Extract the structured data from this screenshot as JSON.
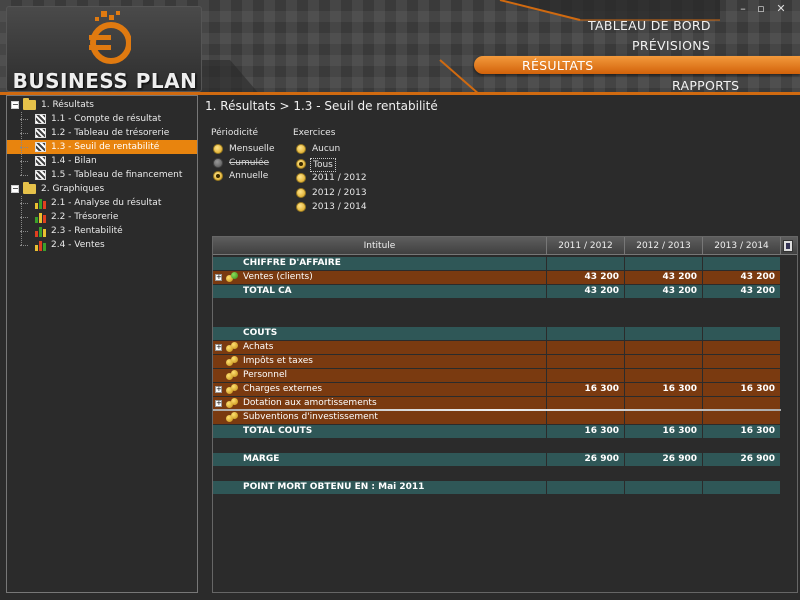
{
  "app": {
    "logo_text": "BUSINESS PLAN"
  },
  "window": {
    "minimize": "–",
    "maximize": "▫",
    "close": "✕"
  },
  "menu": {
    "tableau": "TABLEAU DE BORD",
    "previsions": "PRÉVISIONS",
    "resultats": "RÉSULTATS",
    "rapports": "RAPPORTS"
  },
  "tree": {
    "groups": [
      {
        "label": "1. Résultats",
        "expanded": true,
        "items": [
          {
            "label": "1.1 -  Compte de résultat"
          },
          {
            "label": "1.2 - Tableau de trésorerie"
          },
          {
            "label": "1.3 - Seuil de rentabilité",
            "selected": true
          },
          {
            "label": "1.4 - Bilan"
          },
          {
            "label": "1.5 - Tableau de financement"
          }
        ]
      },
      {
        "label": "2. Graphiques",
        "expanded": true,
        "items": [
          {
            "label": "2.1 - Analyse du résultat"
          },
          {
            "label": "2.2 - Trésorerie"
          },
          {
            "label": "2.3 - Rentabilité"
          },
          {
            "label": "2.4 - Ventes"
          }
        ]
      }
    ],
    "expand_symbol": "−"
  },
  "breadcrumb": "1. Résultats > 1.3 - Seuil de rentabilité",
  "periodicite": {
    "title": "Périodicité",
    "options": [
      "Mensuelle",
      "Cumulée",
      "Annuelle"
    ],
    "selected": "Annuelle",
    "disabled": "Cumulée"
  },
  "exercices": {
    "title": "Exercices",
    "options": [
      "Aucun",
      "Tous",
      "2011 / 2012",
      "2012 / 2013",
      "2013 / 2014"
    ],
    "selected": "Tous"
  },
  "grid": {
    "headers": [
      "Intitule",
      "2011 / 2012",
      "2012 / 2013",
      "2013 / 2014"
    ],
    "plus_symbol": "+",
    "rows": [
      {
        "label": "CHIFFRE D'AFFAIRE",
        "style": "teal",
        "bold": true,
        "values": [
          "",
          "",
          ""
        ]
      },
      {
        "label": "Ventes (clients)",
        "style": "brown",
        "expand": true,
        "icon": "coins-green",
        "values": [
          "43 200",
          "43 200",
          "43 200"
        ]
      },
      {
        "label": "TOTAL CA",
        "style": "teal",
        "bold": true,
        "values": [
          "43 200",
          "43 200",
          "43 200"
        ]
      },
      {
        "label": "",
        "style": "blank",
        "values": [
          "",
          "",
          ""
        ]
      },
      {
        "label": "",
        "style": "blank",
        "values": [
          "",
          "",
          ""
        ]
      },
      {
        "label": "COUTS",
        "style": "teal",
        "bold": true,
        "values": [
          "",
          "",
          ""
        ]
      },
      {
        "label": "Achats",
        "style": "brown",
        "expand": true,
        "icon": "coins",
        "values": [
          "",
          "",
          ""
        ]
      },
      {
        "label": "Impôts et taxes",
        "style": "brown",
        "icon": "coins",
        "values": [
          "",
          "",
          ""
        ]
      },
      {
        "label": "Personnel",
        "style": "brown",
        "icon": "coins",
        "values": [
          "",
          "",
          ""
        ]
      },
      {
        "label": "Charges externes",
        "style": "brown",
        "expand": true,
        "icon": "coins",
        "values": [
          "16 300",
          "16 300",
          "16 300"
        ]
      },
      {
        "label": "Dotation aux amortissements",
        "style": "brown",
        "expand": true,
        "icon": "coins",
        "values": [
          "",
          "",
          ""
        ]
      },
      {
        "label": "Subventions d'investissement",
        "style": "brown",
        "icon": "coins",
        "separator": true,
        "values": [
          "",
          "",
          ""
        ]
      },
      {
        "label": "TOTAL COUTS",
        "style": "teal",
        "bold": true,
        "values": [
          "16 300",
          "16 300",
          "16 300"
        ]
      },
      {
        "label": "",
        "style": "blank",
        "values": [
          "",
          "",
          ""
        ]
      },
      {
        "label": "MARGE",
        "style": "teal",
        "bold": true,
        "values": [
          "26 900",
          "26 900",
          "26 900"
        ]
      },
      {
        "label": "",
        "style": "blank",
        "values": [
          "",
          "",
          ""
        ]
      },
      {
        "label": "POINT MORT OBTENU EN : Mai 2011",
        "style": "teal",
        "bold": true,
        "values": [
          "",
          "",
          ""
        ]
      }
    ]
  },
  "colors": {
    "accent": "#e8840e",
    "teal": "#2f5757",
    "brown": "#7a3a10"
  }
}
